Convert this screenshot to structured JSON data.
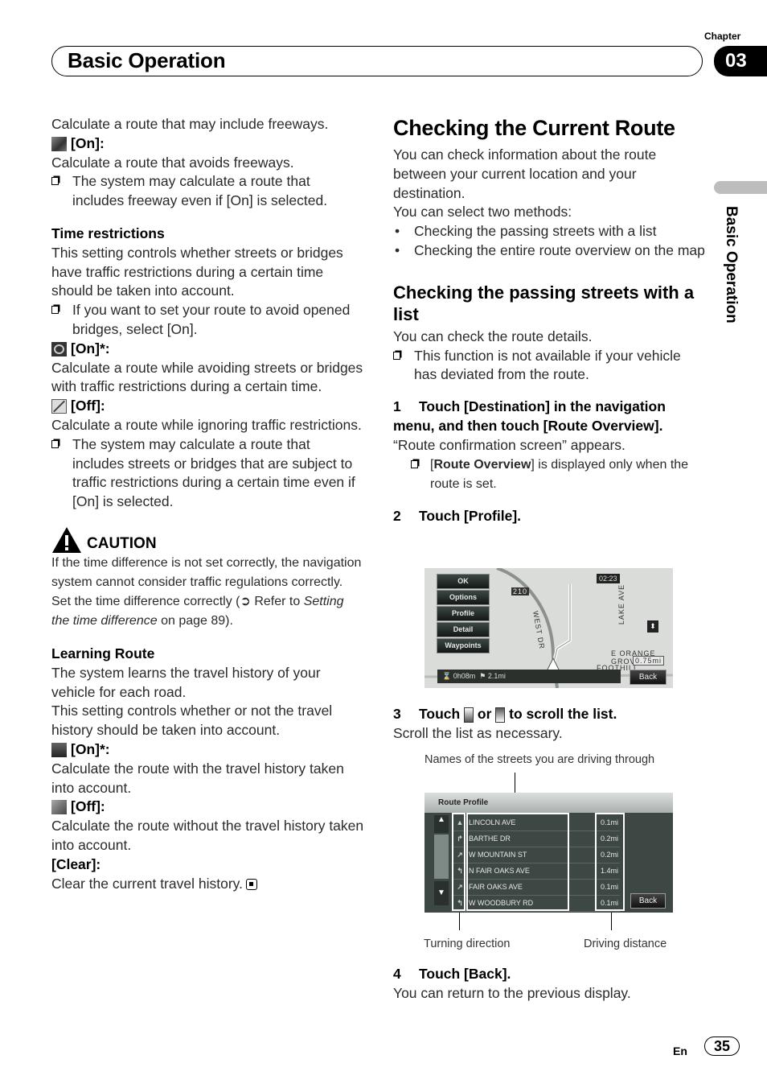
{
  "header": {
    "chapter_label": "Chapter",
    "chapter_number": "03",
    "section_title": "Basic Operation",
    "side_tab_label": "Basic Operation"
  },
  "left": {
    "p1": "Calculate a route that may include freeways.",
    "freeway_on_label": "[On]:",
    "p2": "Calculate a route that avoids freeways.",
    "note1": "The system may calculate a route that includes freeway even if [On] is selected.",
    "time_heading": "Time restrictions",
    "time_desc": "This setting controls whether streets or bridges have traffic restrictions during a certain time should be taken into account.",
    "time_note": "If you want to set your route to avoid opened bridges, select [On].",
    "time_on_label": "[On]*:",
    "time_on_desc": "Calculate a route while avoiding streets or bridges with traffic restrictions during a certain time.",
    "time_off_label": "[Off]:",
    "time_off_desc": "Calculate a route while ignoring traffic restrictions.",
    "time_off_note": "The system may calculate a route that includes streets or bridges that are subject to traffic restrictions during a certain time even if [On] is selected.",
    "caution_title": "CAUTION",
    "caution_text_1": "If the time difference is not set correctly, the navigation system cannot consider traffic regulations correctly. Set the time difference correctly (➲ Refer to ",
    "caution_link": "Setting the time difference",
    "caution_text_2": " on page 89).",
    "learning_heading": "Learning Route",
    "learning_desc_1": "The system learns the travel history of your vehicle for each road.",
    "learning_desc_2": "This setting controls whether or not the travel history should be taken into account.",
    "learning_on_label": "[On]*:",
    "learning_on_desc": "Calculate the route with the travel history taken into account.",
    "learning_off_label": "[Off]:",
    "learning_off_desc": "Calculate the route without the travel history taken into account.",
    "clear_label": "[Clear]:",
    "clear_desc": "Clear the current travel history."
  },
  "right": {
    "title": "Checking the Current Route",
    "intro": "You can check information about the route between your current location and your destination.",
    "methods_intro": "You can select two methods:",
    "methods": [
      "Checking the passing streets with a list",
      "Checking the entire route overview on the map"
    ],
    "sub_heading": "Checking the passing streets with a list",
    "sub_intro": "You can check the route details.",
    "sub_note": "This function is not available if your vehicle has deviated from the route.",
    "step1_num": "1",
    "step1": "Touch [Destination] in the navigation menu, and then touch [Route Overview].",
    "step1_result": "“Route confirmation screen” appears.",
    "step1_note_bold": "Route Overview",
    "step1_note_rest": "] is displayed only when the route is set.",
    "step2_num": "2",
    "step2": "Touch [Profile].",
    "step3_num": "3",
    "step3_a": "Touch ",
    "step3_b": " or ",
    "step3_c": " to scroll the list.",
    "step3_result": "Scroll the list as necessary.",
    "step4_num": "4",
    "step4": "Touch [Back].",
    "step4_result": "You can return to the previous display."
  },
  "map_screen": {
    "menu": [
      "OK",
      "Options",
      "Profile",
      "Detail",
      "Waypoints"
    ],
    "clock": "02:23",
    "status_time": "0h08m",
    "status_distance": "2.1mi",
    "street_labels": [
      "WEST DR",
      "LAKE AVE",
      "E ORANGE GROVE BL",
      "FOOTHILL"
    ],
    "route_shield": "210",
    "scale": "0.75mi",
    "back_label": "Back"
  },
  "profile_screen": {
    "title": "Route Profile",
    "rows": [
      {
        "dir": "▲",
        "street": "LINCOLN AVE",
        "distance": "0.1mi"
      },
      {
        "dir": "↱",
        "street": "BARTHE DR",
        "distance": "0.2mi"
      },
      {
        "dir": "↗",
        "street": "W MOUNTAIN ST",
        "distance": "0.2mi"
      },
      {
        "dir": "↰",
        "street": "N FAIR OAKS AVE",
        "distance": "1.4mi"
      },
      {
        "dir": "↗",
        "street": "FAIR OAKS AVE",
        "distance": "0.1mi"
      },
      {
        "dir": "↰",
        "street": "W WOODBURY RD",
        "distance": "0.1mi"
      }
    ],
    "back_label": "Back",
    "caption_streets": "Names of the streets you are driving through",
    "caption_direction": "Turning direction",
    "caption_distance": "Driving distance"
  },
  "footer": {
    "lang": "En",
    "page": "35"
  }
}
